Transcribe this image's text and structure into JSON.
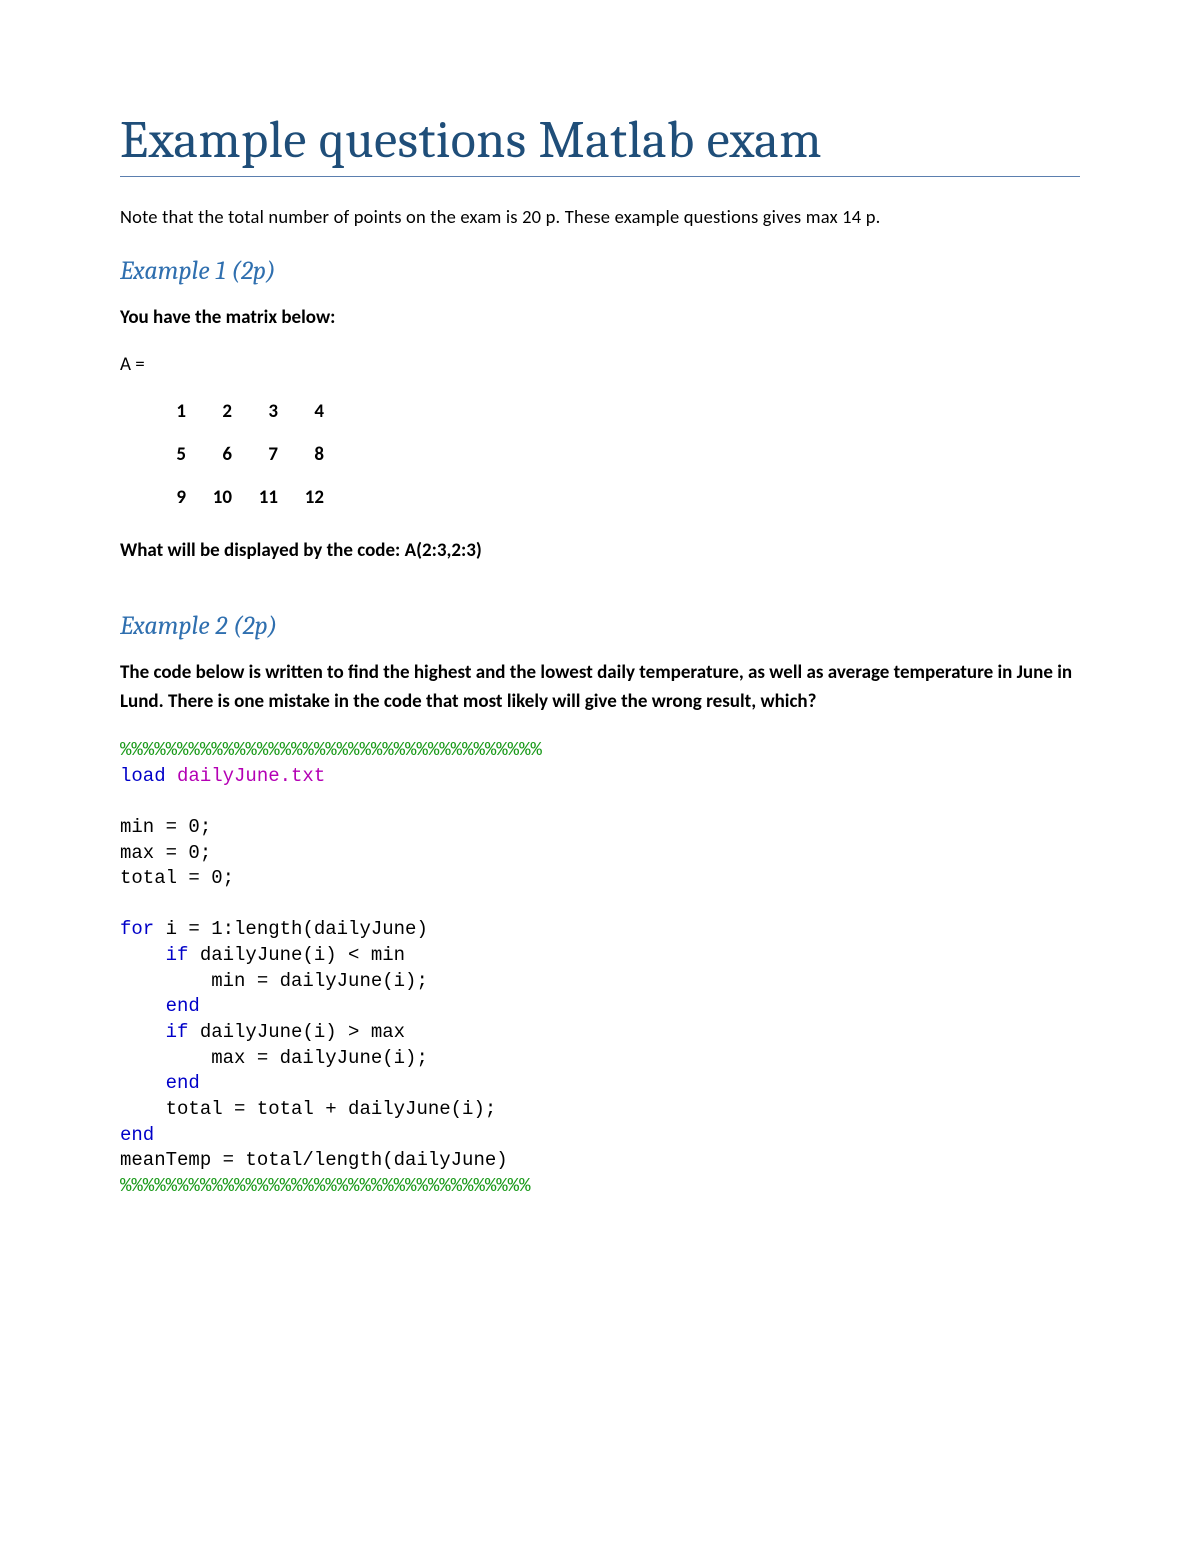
{
  "title": "Example questions Matlab exam",
  "note": "Note that the total number of points on the exam is 20 p. These example questions gives max 14 p.",
  "ex1": {
    "heading": "Example 1 (2p)",
    "intro": "You have the matrix below:",
    "matrixLabel": "A =",
    "matrix": [
      [
        "1",
        "2",
        "3",
        "4"
      ],
      [
        "5",
        "6",
        "7",
        "8"
      ],
      [
        "9",
        "10",
        "11",
        "12"
      ]
    ],
    "question": "What will be displayed by the code: A(2:3,2:3)"
  },
  "ex2": {
    "heading": "Example 2 (2p)",
    "intro": "The code below is written to find the highest and the lowest daily temperature, as well as average temperature in June in Lund. There is one mistake in the code that most likely will give the wrong result, which?",
    "code": {
      "commentBar1": "%%%%%%%%%%%%%%%%%%%%%%%%%%%%%%%%%%%%%",
      "loadKw": "load",
      "loadArg": "dailyJune.txt",
      "l_min": "min = 0;",
      "l_max": "max = 0;",
      "l_total": "total = 0;",
      "forKw": "for",
      "forRest": " i = 1:length(dailyJune)",
      "ifKw1": "if",
      "ifRest1": " dailyJune(i) < min",
      "assign1": "        min = dailyJune(i);",
      "endKw1": "end",
      "ifKw2": "if",
      "ifRest2": " dailyJune(i) > max",
      "assign2": "        max = dailyJune(i);",
      "endKw2": "end",
      "loopBody": "    total = total + dailyJune(i);",
      "endKw3": "end",
      "meanLine": "meanTemp = total/length(dailyJune)",
      "commentBar2": "%%%%%%%%%%%%%%%%%%%%%%%%%%%%%%%%%%%%"
    }
  }
}
